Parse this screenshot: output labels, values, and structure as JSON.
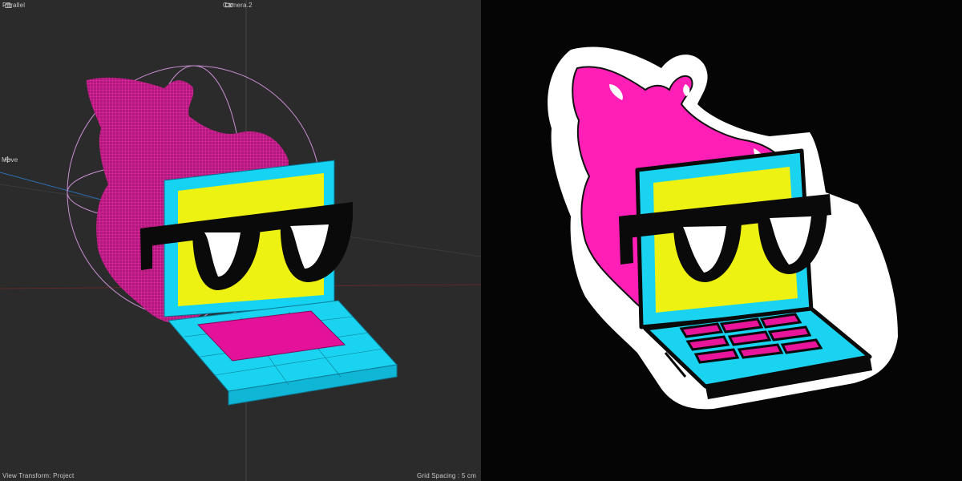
{
  "viewport": {
    "projection_label": "Parallel",
    "camera_label": "Camera.2",
    "tool_label": "Move",
    "view_transform_label": "View Transform: Project",
    "grid_spacing_label": "Grid Spacing : 5 cm",
    "background_color": "#2b2b2b"
  },
  "preview": {
    "background_color": "#050505"
  },
  "colors": {
    "flame_pink": "#ff1fb6",
    "screen_cyan": "#1ad3f0",
    "screen_yellow": "#eef212",
    "keyboard_magenta": "#e8149a",
    "glasses_black": "#0a0a0a",
    "sticker_border": "#ffffff"
  },
  "icons": [
    "camera-icon",
    "move-icon",
    "lock-icon"
  ]
}
